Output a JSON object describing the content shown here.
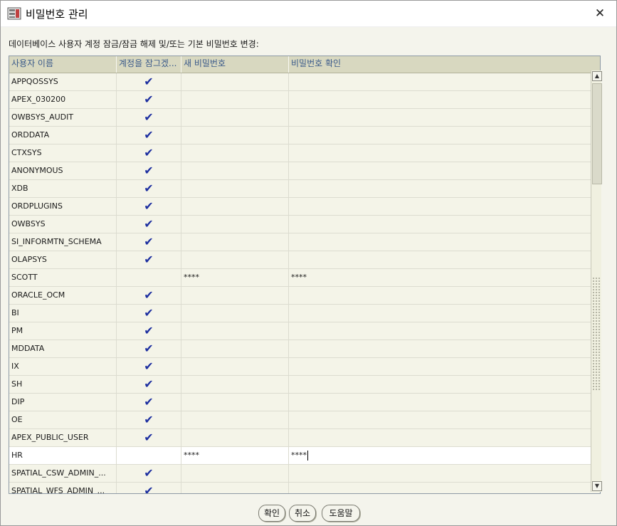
{
  "window": {
    "title": "비밀번호 관리",
    "close_icon": "✕"
  },
  "instruction": "데이터베이스 사용자 계정 잠금/잠금 해제 및/또는 기본 비밀번호 변경:",
  "columns": [
    "사용자 이름",
    "계정을 잠그겠...",
    "새 비밀번호",
    "비밀번호 확인"
  ],
  "check_glyph": "✔",
  "rows": [
    {
      "user": "APPQOSSYS",
      "locked": true,
      "new_pw": "",
      "confirm_pw": ""
    },
    {
      "user": "APEX_030200",
      "locked": true,
      "new_pw": "",
      "confirm_pw": ""
    },
    {
      "user": "OWBSYS_AUDIT",
      "locked": true,
      "new_pw": "",
      "confirm_pw": ""
    },
    {
      "user": "ORDDATA",
      "locked": true,
      "new_pw": "",
      "confirm_pw": ""
    },
    {
      "user": "CTXSYS",
      "locked": true,
      "new_pw": "",
      "confirm_pw": ""
    },
    {
      "user": "ANONYMOUS",
      "locked": true,
      "new_pw": "",
      "confirm_pw": ""
    },
    {
      "user": "XDB",
      "locked": true,
      "new_pw": "",
      "confirm_pw": ""
    },
    {
      "user": "ORDPLUGINS",
      "locked": true,
      "new_pw": "",
      "confirm_pw": ""
    },
    {
      "user": "OWBSYS",
      "locked": true,
      "new_pw": "",
      "confirm_pw": ""
    },
    {
      "user": "SI_INFORMTN_SCHEMA",
      "locked": true,
      "new_pw": "",
      "confirm_pw": ""
    },
    {
      "user": "OLAPSYS",
      "locked": true,
      "new_pw": "",
      "confirm_pw": ""
    },
    {
      "user": "SCOTT",
      "locked": false,
      "new_pw": "****",
      "confirm_pw": "****"
    },
    {
      "user": "ORACLE_OCM",
      "locked": true,
      "new_pw": "",
      "confirm_pw": ""
    },
    {
      "user": "BI",
      "locked": true,
      "new_pw": "",
      "confirm_pw": ""
    },
    {
      "user": "PM",
      "locked": true,
      "new_pw": "",
      "confirm_pw": ""
    },
    {
      "user": "MDDATA",
      "locked": true,
      "new_pw": "",
      "confirm_pw": ""
    },
    {
      "user": "IX",
      "locked": true,
      "new_pw": "",
      "confirm_pw": ""
    },
    {
      "user": "SH",
      "locked": true,
      "new_pw": "",
      "confirm_pw": ""
    },
    {
      "user": "DIP",
      "locked": true,
      "new_pw": "",
      "confirm_pw": ""
    },
    {
      "user": "OE",
      "locked": true,
      "new_pw": "",
      "confirm_pw": ""
    },
    {
      "user": "APEX_PUBLIC_USER",
      "locked": true,
      "new_pw": "",
      "confirm_pw": ""
    },
    {
      "user": "HR",
      "locked": false,
      "new_pw": "****",
      "confirm_pw": "****",
      "editing": true
    },
    {
      "user": "SPATIAL_CSW_ADMIN_...",
      "locked": true,
      "new_pw": "",
      "confirm_pw": ""
    },
    {
      "user": "SPATIAL_WFS_ADMIN_...",
      "locked": true,
      "new_pw": "",
      "confirm_pw": ""
    }
  ],
  "buttons": {
    "ok": "확인",
    "cancel": "취소",
    "help": "도움말"
  },
  "scrollbar": {
    "up_icon": "▲",
    "down_icon": "▼"
  }
}
